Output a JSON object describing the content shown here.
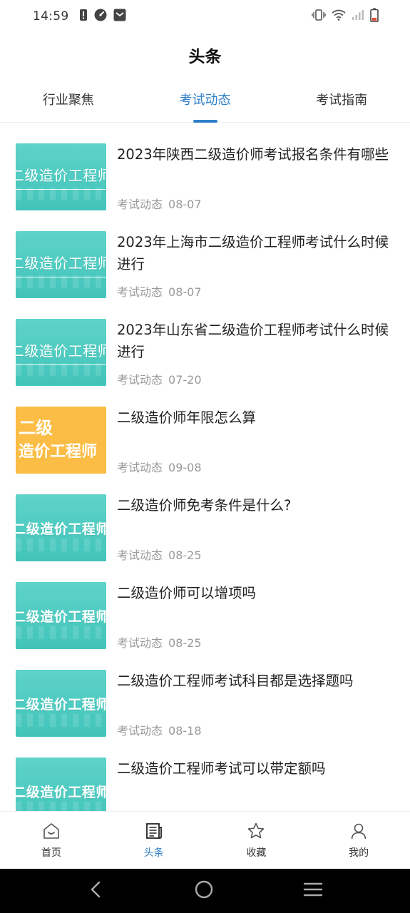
{
  "status_bar": {
    "time": "14:59",
    "left_icons": [
      "sim-alert-icon",
      "speedometer-icon",
      "mail-icon"
    ],
    "right_icons": [
      "vibrate-icon",
      "wifi-icon",
      "signal-icon",
      "battery-icon"
    ]
  },
  "header": {
    "title": "头条"
  },
  "tabs": [
    {
      "label": "行业聚焦",
      "active": false
    },
    {
      "label": "考试动态",
      "active": true
    },
    {
      "label": "考试指南",
      "active": false
    }
  ],
  "news": [
    {
      "thumb_text": "二级造价工程师",
      "thumb_style": "teal-outline",
      "title": "2023年陕西二级造价师考试报名条件有哪些",
      "category": "考试动态",
      "date": "08-07"
    },
    {
      "thumb_text": "二级造价工程师",
      "thumb_style": "teal-outline",
      "title": "2023年上海市二级造价工程师考试什么时候进行",
      "category": "考试动态",
      "date": "08-07"
    },
    {
      "thumb_text": "二级造价工程师",
      "thumb_style": "teal-outline",
      "title": "2023年山东省二级造价工程师考试什么时候进行",
      "category": "考试动态",
      "date": "07-20"
    },
    {
      "thumb_text_line1": "二级",
      "thumb_text_line2": "造价工程师",
      "thumb_style": "yellow",
      "title": "二级造价师年限怎么算",
      "category": "考试动态",
      "date": "09-08"
    },
    {
      "thumb_text": "二级造价工程师",
      "thumb_style": "teal-bold",
      "title": "二级造价师免考条件是什么?",
      "category": "考试动态",
      "date": "08-25"
    },
    {
      "thumb_text": "二级造价工程师",
      "thumb_style": "teal-bold",
      "title": "二级造价师可以增项吗",
      "category": "考试动态",
      "date": "08-25"
    },
    {
      "thumb_text": "二级造价工程师",
      "thumb_style": "teal-bold",
      "title": "二级造价工程师考试科目都是选择题吗",
      "category": "考试动态",
      "date": "08-18"
    },
    {
      "thumb_text": "二级造价工程师",
      "thumb_style": "teal-bold",
      "title": "二级造价工程师考试可以带定额吗",
      "category": "",
      "date": ""
    }
  ],
  "bottom_nav": [
    {
      "label": "首页",
      "icon": "home-icon",
      "active": false
    },
    {
      "label": "头条",
      "icon": "news-icon",
      "active": true
    },
    {
      "label": "收藏",
      "icon": "star-icon",
      "active": false
    },
    {
      "label": "我的",
      "icon": "user-icon",
      "active": false
    }
  ],
  "colors": {
    "accent": "#2f80c8",
    "thumb_teal": "#4ecbc1",
    "thumb_yellow": "#fbbd45",
    "meta_gray": "#999999"
  },
  "system_bar": {
    "icons": [
      "back-icon",
      "home-circle-icon",
      "menu-icon"
    ]
  }
}
